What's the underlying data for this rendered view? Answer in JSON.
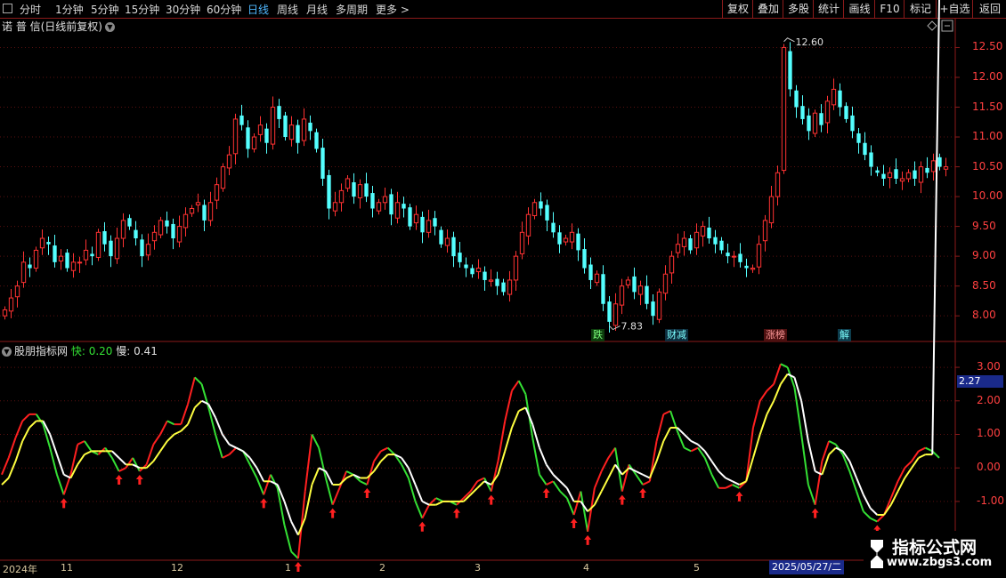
{
  "toolbar": {
    "periods": [
      "分时",
      "1分钟",
      "5分钟",
      "15分钟",
      "30分钟",
      "60分钟",
      "日线",
      "周线",
      "月线",
      "多周期",
      "更多 >"
    ],
    "active_period": "日线",
    "tools": [
      "复权",
      "叠加",
      "多股",
      "统计",
      "画线",
      "F10",
      "标记",
      "+自选",
      "返回"
    ]
  },
  "main": {
    "stock_title": "诺 普 信(日线前复权)",
    "high_label": "12.60",
    "low_label": "7.83",
    "events": [
      "跌",
      "财减",
      "涨榜",
      "解"
    ],
    "price_ticks": [
      "12.50",
      "12.00",
      "11.50",
      "11.00",
      "10.50",
      "10.00",
      "9.50",
      "9.00",
      "8.50",
      "8.00"
    ]
  },
  "indicator": {
    "name": "股朋指标网",
    "fast_label": "快: 0.20",
    "slow_label": "慢: 0.41",
    "current_value": "2.27",
    "ticks": [
      "3.00",
      "2.00",
      "1.00",
      "0.00",
      "-1.00"
    ]
  },
  "axis": {
    "labels": [
      "2024年",
      "11",
      "12",
      "1",
      "2",
      "3",
      "4",
      "5"
    ],
    "date_label": "2025/05/27/二"
  },
  "watermark": {
    "line1": "指标公式网",
    "line2": "www.zbgs3.com"
  },
  "colors": {
    "up": "#ff3232",
    "down": "#54ffff",
    "border": "#8b1a1a",
    "fast": "#34e034",
    "slow": "#ffffff"
  },
  "chart_data": [
    {
      "type": "candlestick",
      "title": "诺 普 信(日线前复权)",
      "ylim": [
        7.6,
        12.85
      ],
      "ticks": [
        8.0,
        8.5,
        9.0,
        9.5,
        10.0,
        10.5,
        11.0,
        11.5,
        12.0,
        12.5
      ],
      "close": [
        8.1,
        8.3,
        8.5,
        8.9,
        8.8,
        9.1,
        9.3,
        9.2,
        8.9,
        9.0,
        8.8,
        8.9,
        8.9,
        9.1,
        9.0,
        9.4,
        9.2,
        9.0,
        9.3,
        9.6,
        9.5,
        9.3,
        9.0,
        9.2,
        9.4,
        9.6,
        9.5,
        9.3,
        9.5,
        9.7,
        9.8,
        9.9,
        9.6,
        9.9,
        10.2,
        10.5,
        10.7,
        11.3,
        11.2,
        10.8,
        11.0,
        11.2,
        10.9,
        11.5,
        11.3,
        11.0,
        11.2,
        10.9,
        11.3,
        11.1,
        10.8,
        10.3,
        9.8,
        9.9,
        10.1,
        10.3,
        10.0,
        10.2,
        10.0,
        9.8,
        9.9,
        10.0,
        9.7,
        9.9,
        9.8,
        9.5,
        9.7,
        9.4,
        9.6,
        9.5,
        9.2,
        9.3,
        9.0,
        8.9,
        8.8,
        8.7,
        8.8,
        8.6,
        8.6,
        8.5,
        8.4,
        8.6,
        9.0,
        9.4,
        9.7,
        9.9,
        9.8,
        9.6,
        9.4,
        9.2,
        9.3,
        9.4,
        9.1,
        8.8,
        8.6,
        8.7,
        8.2,
        7.9,
        8.2,
        8.5,
        8.6,
        8.4,
        8.5,
        8.2,
        8.0,
        8.4,
        8.7,
        9.0,
        9.2,
        9.3,
        9.1,
        9.4,
        9.5,
        9.3,
        9.2,
        9.1,
        9.0,
        9.0,
        8.9,
        8.8,
        8.8,
        9.2,
        9.6,
        10.0,
        10.4,
        12.5,
        11.8,
        11.5,
        11.3,
        11.1,
        11.4,
        11.2,
        11.6,
        11.8,
        11.5,
        11.3,
        11.1,
        10.9,
        10.7,
        10.5,
        10.4,
        10.3,
        10.4,
        10.3,
        10.3,
        10.4,
        10.3,
        10.5,
        10.4,
        10.6,
        10.5,
        10.5
      ],
      "high_label": 12.6,
      "low_label": 7.83
    },
    {
      "type": "line",
      "title": "股朋指标网",
      "ylim": [
        -2.7,
        3.4
      ],
      "ticks": [
        3.0,
        2.0,
        1.0,
        0.0,
        -1.0
      ],
      "series": [
        {
          "name": "快",
          "values": [
            -0.2,
            0.3,
            0.9,
            1.4,
            1.6,
            1.6,
            1.3,
            0.6,
            -0.2,
            -0.8,
            -0.2,
            0.7,
            0.8,
            0.5,
            0.4,
            0.6,
            0.3,
            -0.1,
            0.0,
            0.3,
            -0.1,
            0.1,
            0.7,
            1.0,
            1.4,
            1.3,
            1.3,
            1.9,
            2.7,
            2.5,
            1.8,
            1.0,
            0.3,
            0.4,
            0.6,
            0.5,
            0.1,
            -0.3,
            -0.8,
            -0.2,
            -0.6,
            -1.7,
            -2.5,
            -2.7,
            -0.7,
            1.0,
            0.6,
            -0.3,
            -1.1,
            -0.6,
            -0.1,
            -0.2,
            -0.4,
            -0.5,
            0.2,
            0.5,
            0.6,
            0.4,
            0.1,
            -0.3,
            -1.0,
            -1.5,
            -1.1,
            -0.9,
            -1.0,
            -1.0,
            -1.1,
            -0.9,
            -0.7,
            -0.4,
            -0.3,
            -0.7,
            0.2,
            1.4,
            2.3,
            2.6,
            2.2,
            0.9,
            -0.2,
            -0.5,
            -0.4,
            -0.7,
            -0.9,
            -1.4,
            -0.7,
            -1.9,
            -0.6,
            -0.1,
            0.3,
            0.6,
            -0.7,
            0.1,
            -0.2,
            -0.5,
            -0.4,
            0.8,
            1.6,
            1.7,
            1.1,
            0.6,
            0.5,
            0.6,
            0.3,
            -0.2,
            -0.6,
            -0.6,
            -0.5,
            -0.6,
            -0.4,
            1.2,
            2.0,
            2.3,
            2.5,
            3.1,
            3.0,
            2.4,
            1.0,
            -0.5,
            -1.1,
            0.2,
            0.8,
            0.7,
            0.4,
            -0.1,
            -0.7,
            -1.3,
            -1.5,
            -1.6,
            -1.4,
            -0.9,
            -0.4,
            0.0,
            0.2,
            0.5,
            0.6,
            0.5,
            0.3
          ]
        },
        {
          "name": "慢",
          "values": [
            -0.5,
            -0.3,
            0.2,
            0.8,
            1.2,
            1.4,
            1.4,
            1.0,
            0.4,
            -0.2,
            -0.3,
            0.1,
            0.4,
            0.5,
            0.5,
            0.5,
            0.5,
            0.3,
            0.1,
            0.1,
            0.0,
            0.0,
            0.2,
            0.5,
            0.8,
            1.0,
            1.1,
            1.3,
            1.8,
            2.0,
            1.9,
            1.5,
            1.0,
            0.7,
            0.6,
            0.5,
            0.3,
            0.0,
            -0.4,
            -0.4,
            -0.5,
            -1.0,
            -1.6,
            -2.0,
            -1.5,
            -0.5,
            0.0,
            -0.1,
            -0.5,
            -0.5,
            -0.3,
            -0.2,
            -0.3,
            -0.3,
            -0.1,
            0.2,
            0.4,
            0.4,
            0.3,
            0.0,
            -0.5,
            -1.0,
            -1.1,
            -1.1,
            -1.0,
            -1.0,
            -1.0,
            -1.0,
            -0.8,
            -0.6,
            -0.4,
            -0.5,
            -0.2,
            0.5,
            1.2,
            1.7,
            1.8,
            1.3,
            0.6,
            0.1,
            -0.2,
            -0.4,
            -0.6,
            -1.0,
            -1.0,
            -1.3,
            -1.1,
            -0.7,
            -0.3,
            0.1,
            -0.2,
            0.0,
            -0.1,
            -0.2,
            -0.3,
            0.2,
            0.8,
            1.2,
            1.2,
            1.0,
            0.8,
            0.7,
            0.5,
            0.2,
            -0.1,
            -0.3,
            -0.4,
            -0.5,
            -0.4,
            0.3,
            1.0,
            1.6,
            2.0,
            2.5,
            2.8,
            2.7,
            2.0,
            0.8,
            -0.1,
            -0.2,
            0.4,
            0.6,
            0.5,
            0.2,
            -0.3,
            -0.8,
            -1.2,
            -1.4,
            -1.4,
            -1.1,
            -0.7,
            -0.3,
            0.0,
            0.3,
            0.4,
            0.4
          ]
        }
      ]
    }
  ]
}
